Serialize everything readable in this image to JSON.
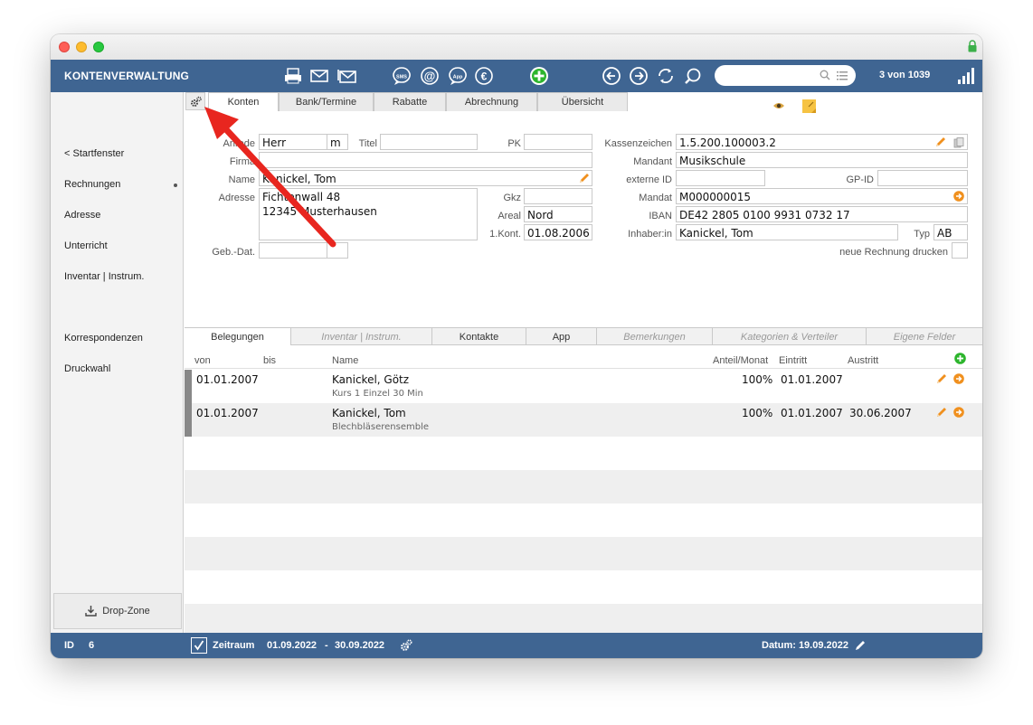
{
  "app": {
    "title": "KONTENVERWALTUNG",
    "record_counter": "3 von 1039",
    "search_placeholder": ""
  },
  "toolbar": {
    "icons": [
      "print-icon",
      "mail-icon",
      "mail-open-icon",
      "sms-icon",
      "at-icon",
      "app-icon",
      "euro-icon",
      "add-icon",
      "back-icon",
      "forward-icon",
      "refresh-icon",
      "search-icon"
    ],
    "sms_label": "SMS",
    "app_label": "App"
  },
  "sidebar": {
    "items": [
      {
        "label": "< Startfenster"
      },
      {
        "label": "Rechnungen"
      },
      {
        "label": "Adresse"
      },
      {
        "label": "Unterricht"
      },
      {
        "label": "Inventar | Instrum."
      },
      {
        "label": "Korrespondenzen"
      },
      {
        "label": "Druckwahl"
      }
    ],
    "dropzone_label": "Drop-Zone"
  },
  "tabs_top": [
    {
      "label": "Konten",
      "active": true
    },
    {
      "label": "Bank/Termine"
    },
    {
      "label": "Rabatte"
    },
    {
      "label": "Abrechnung"
    },
    {
      "label": "Übersicht"
    }
  ],
  "form": {
    "anrede_label": "Anrede",
    "anrede_value": "Herr",
    "gender_value": "m",
    "titel_label": "Titel",
    "titel_value": "",
    "pk_label": "PK",
    "pk_value": "",
    "firma_label": "Firma",
    "firma_value": "",
    "name_label": "Name",
    "name_value": "Kanickel, Tom",
    "adresse_label": "Adresse",
    "adresse_value": "Fichtenwall 48\n12345 Musterhausen",
    "gkz_label": "Gkz",
    "gkz_value": "",
    "areal_label": "Areal",
    "areal_value": "Nord",
    "kont_label": "1.Kont.",
    "kont_value": "01.08.2006",
    "geb_label": "Geb.-Dat.",
    "geb_value": "",
    "kassenzeichen_label": "Kassenzeichen",
    "kassenzeichen_value": "1.5.200.100003.2",
    "mandant_label": "Mandant",
    "mandant_value": "Musikschule",
    "externe_id_label": "externe ID",
    "externe_id_value": "",
    "gpid_label": "GP-ID",
    "gpid_value": "",
    "mandat_label": "Mandat",
    "mandat_value": "M000000015",
    "iban_label": "IBAN",
    "iban_value": "DE42 2805 0100 9931 0732 17",
    "inhaber_label": "Inhaber:in",
    "inhaber_value": "Kanickel, Tom",
    "typ_label": "Typ",
    "typ_value": "AB",
    "neue_rechnung_label": "neue Rechnung drucken"
  },
  "tabs_lower": [
    {
      "label": "Belegungen",
      "active": true
    },
    {
      "label": "Inventar | Instrum.",
      "italic": true
    },
    {
      "label": "Kontakte"
    },
    {
      "label": "App"
    },
    {
      "label": "Bemerkungen",
      "italic": true
    },
    {
      "label": "Kategorien & Verteiler",
      "italic": true
    },
    {
      "label": "Eigene Felder",
      "italic": true
    }
  ],
  "grid": {
    "headers": {
      "von": "von",
      "bis": "bis",
      "name": "Name",
      "anteil": "Anteil/Monat",
      "eintritt": "Eintritt",
      "austritt": "Austritt"
    },
    "rows": [
      {
        "von": "01.01.2007",
        "bis": "",
        "name": "Kanickel, Götz",
        "sub": "Kurs 1 Einzel 30 Min",
        "anteil": "100%",
        "eintritt": "01.01.2007",
        "austritt": ""
      },
      {
        "von": "01.01.2007",
        "bis": "",
        "name": "Kanickel, Tom",
        "sub": "Blechbläserensemble",
        "anteil": "100%",
        "eintritt": "01.01.2007",
        "austritt": "30.06.2007"
      }
    ]
  },
  "status": {
    "id_label": "ID",
    "id_value": "6",
    "zeitraum_label": "Zeitraum",
    "zeitraum_from": "01.09.2022",
    "zeitraum_sep": "-",
    "zeitraum_to": "30.09.2022",
    "datum_label": "Datum: 19.09.2022"
  },
  "colors": {
    "toolbar_blue": "#3f6592",
    "annotation_arrow": "#e8261f",
    "accent_orange": "#f0901e",
    "add_green": "#2db52d"
  }
}
